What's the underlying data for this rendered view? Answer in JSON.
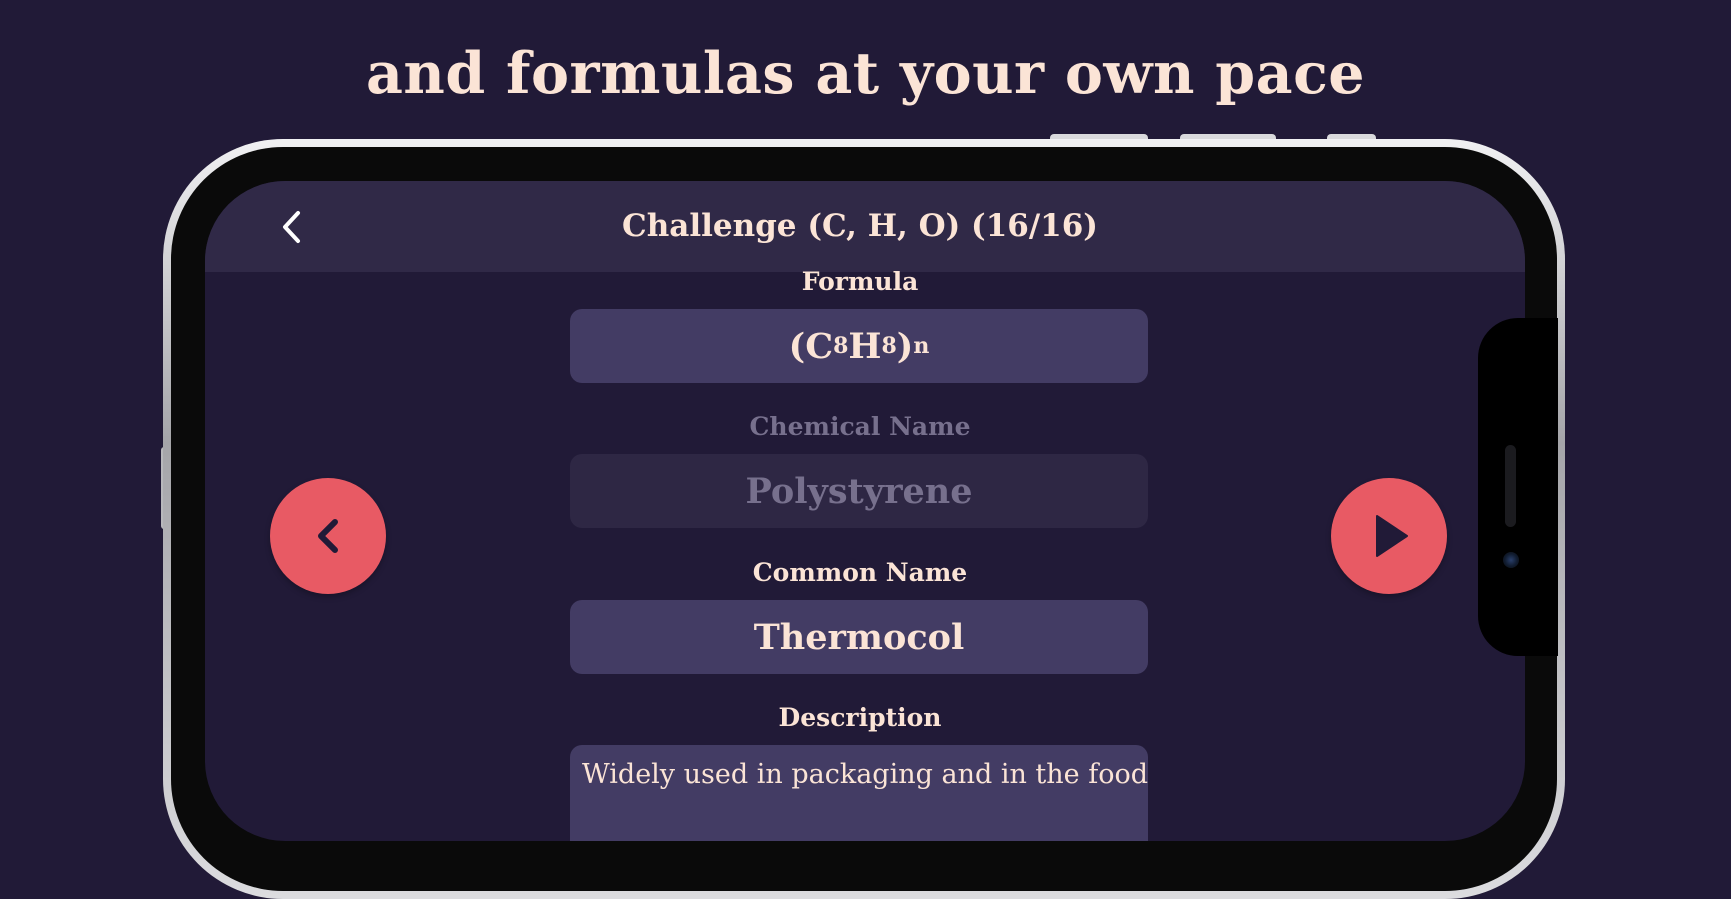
{
  "headline": "and formulas at your own pace",
  "header": {
    "title": "Challenge (C, H, O) (16/16)",
    "back_icon": "chevron-left-icon"
  },
  "fields": {
    "formula": {
      "label": "Formula",
      "value_main": "(C",
      "value_sub1": "8",
      "value_mid": "H",
      "value_sub2": "8",
      "value_close": ")",
      "value_sub3": "n"
    },
    "chemical_name": {
      "label": "Chemical Name",
      "value": "Polystyrene"
    },
    "common_name": {
      "label": "Common Name",
      "value": "Thermocol"
    },
    "description": {
      "label": "Description",
      "value": "Widely used in packaging and in the food-"
    }
  },
  "navigation": {
    "prev_icon": "chevron-left-icon",
    "next_icon": "play-icon",
    "accent_color": "#e85a64"
  },
  "colors": {
    "background": "#211a37",
    "header": "#302947",
    "field": "#433c64",
    "text": "#fbe4d6"
  }
}
